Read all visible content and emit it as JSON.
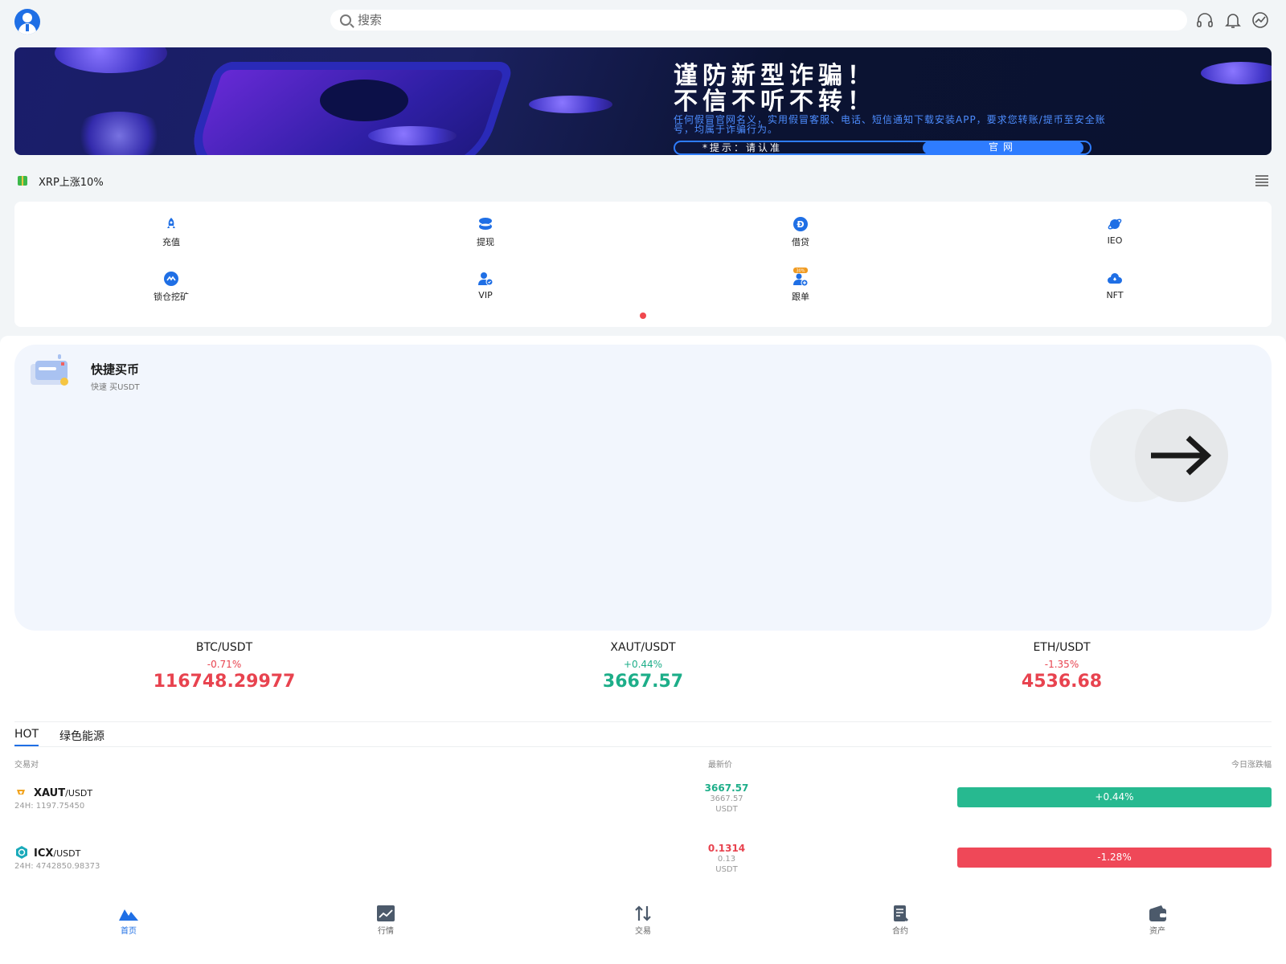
{
  "header": {
    "search_placeholder": "搜索",
    "icons": [
      "avatar",
      "headset-icon",
      "bell-icon",
      "chart-icon"
    ]
  },
  "banner": {
    "line1": "谨防新型诈骗！",
    "line2": "不信不听不转！",
    "desc": "任何假冒官网名义，实用假冒客服、电话、短信通知下载安装APP，要求您转账/提币至安全账号，均属于诈骗行为。",
    "tip": "*提示：请认准",
    "official": "官网"
  },
  "notice": {
    "text": "XRP上涨10%"
  },
  "menu": {
    "items": [
      {
        "label": "充值",
        "icon": "rocket-icon"
      },
      {
        "label": "提现",
        "icon": "coins-icon"
      },
      {
        "label": "借贷",
        "icon": "loan-icon"
      },
      {
        "label": "IEO",
        "icon": "planet-icon"
      },
      {
        "label": "锁仓挖矿",
        "icon": "mining-icon"
      },
      {
        "label": "VIP",
        "icon": "vip-user-icon"
      },
      {
        "label": "跟单",
        "icon": "copy-trade-icon",
        "badge": "30%"
      },
      {
        "label": "NFT",
        "icon": "nft-cloud-icon"
      }
    ]
  },
  "quick_buy": {
    "title": "快捷买币",
    "subtitle": "快速 买USDT"
  },
  "tickers": [
    {
      "pair": "BTC/USDT",
      "change": "-0.71%",
      "price": "116748.29977",
      "dir": "down"
    },
    {
      "pair": "XAUT/USDT",
      "change": "+0.44%",
      "price": "3667.57",
      "dir": "up"
    },
    {
      "pair": "ETH/USDT",
      "change": "-1.35%",
      "price": "4536.68",
      "dir": "down"
    }
  ],
  "tabs": [
    "HOT",
    "绿色能源"
  ],
  "table": {
    "headers": [
      "交易对",
      "最新价",
      "今日涨跌幅"
    ],
    "rows": [
      {
        "base": "XAUT",
        "quote": "/USDT",
        "vol": "24H: 1197.75450",
        "price": "3667.57",
        "price2": "3667.57",
        "unit": "USDT",
        "change": "+0.44%",
        "dir": "up"
      },
      {
        "base": "ICX",
        "quote": "/USDT",
        "vol": "24H: 4742850.98373",
        "price": "0.1314",
        "price2": "0.13",
        "unit": "USDT",
        "change": "-1.28%",
        "dir": "down"
      }
    ]
  },
  "bottom_nav": [
    {
      "label": "首页",
      "icon": "home-icon",
      "active": true
    },
    {
      "label": "行情",
      "icon": "market-icon"
    },
    {
      "label": "交易",
      "icon": "trade-icon"
    },
    {
      "label": "合约",
      "icon": "contract-icon"
    },
    {
      "label": "资产",
      "icon": "wallet-icon"
    }
  ],
  "colors": {
    "accent": "#1f6fe5",
    "up": "#27b990",
    "down": "#ef4858"
  }
}
